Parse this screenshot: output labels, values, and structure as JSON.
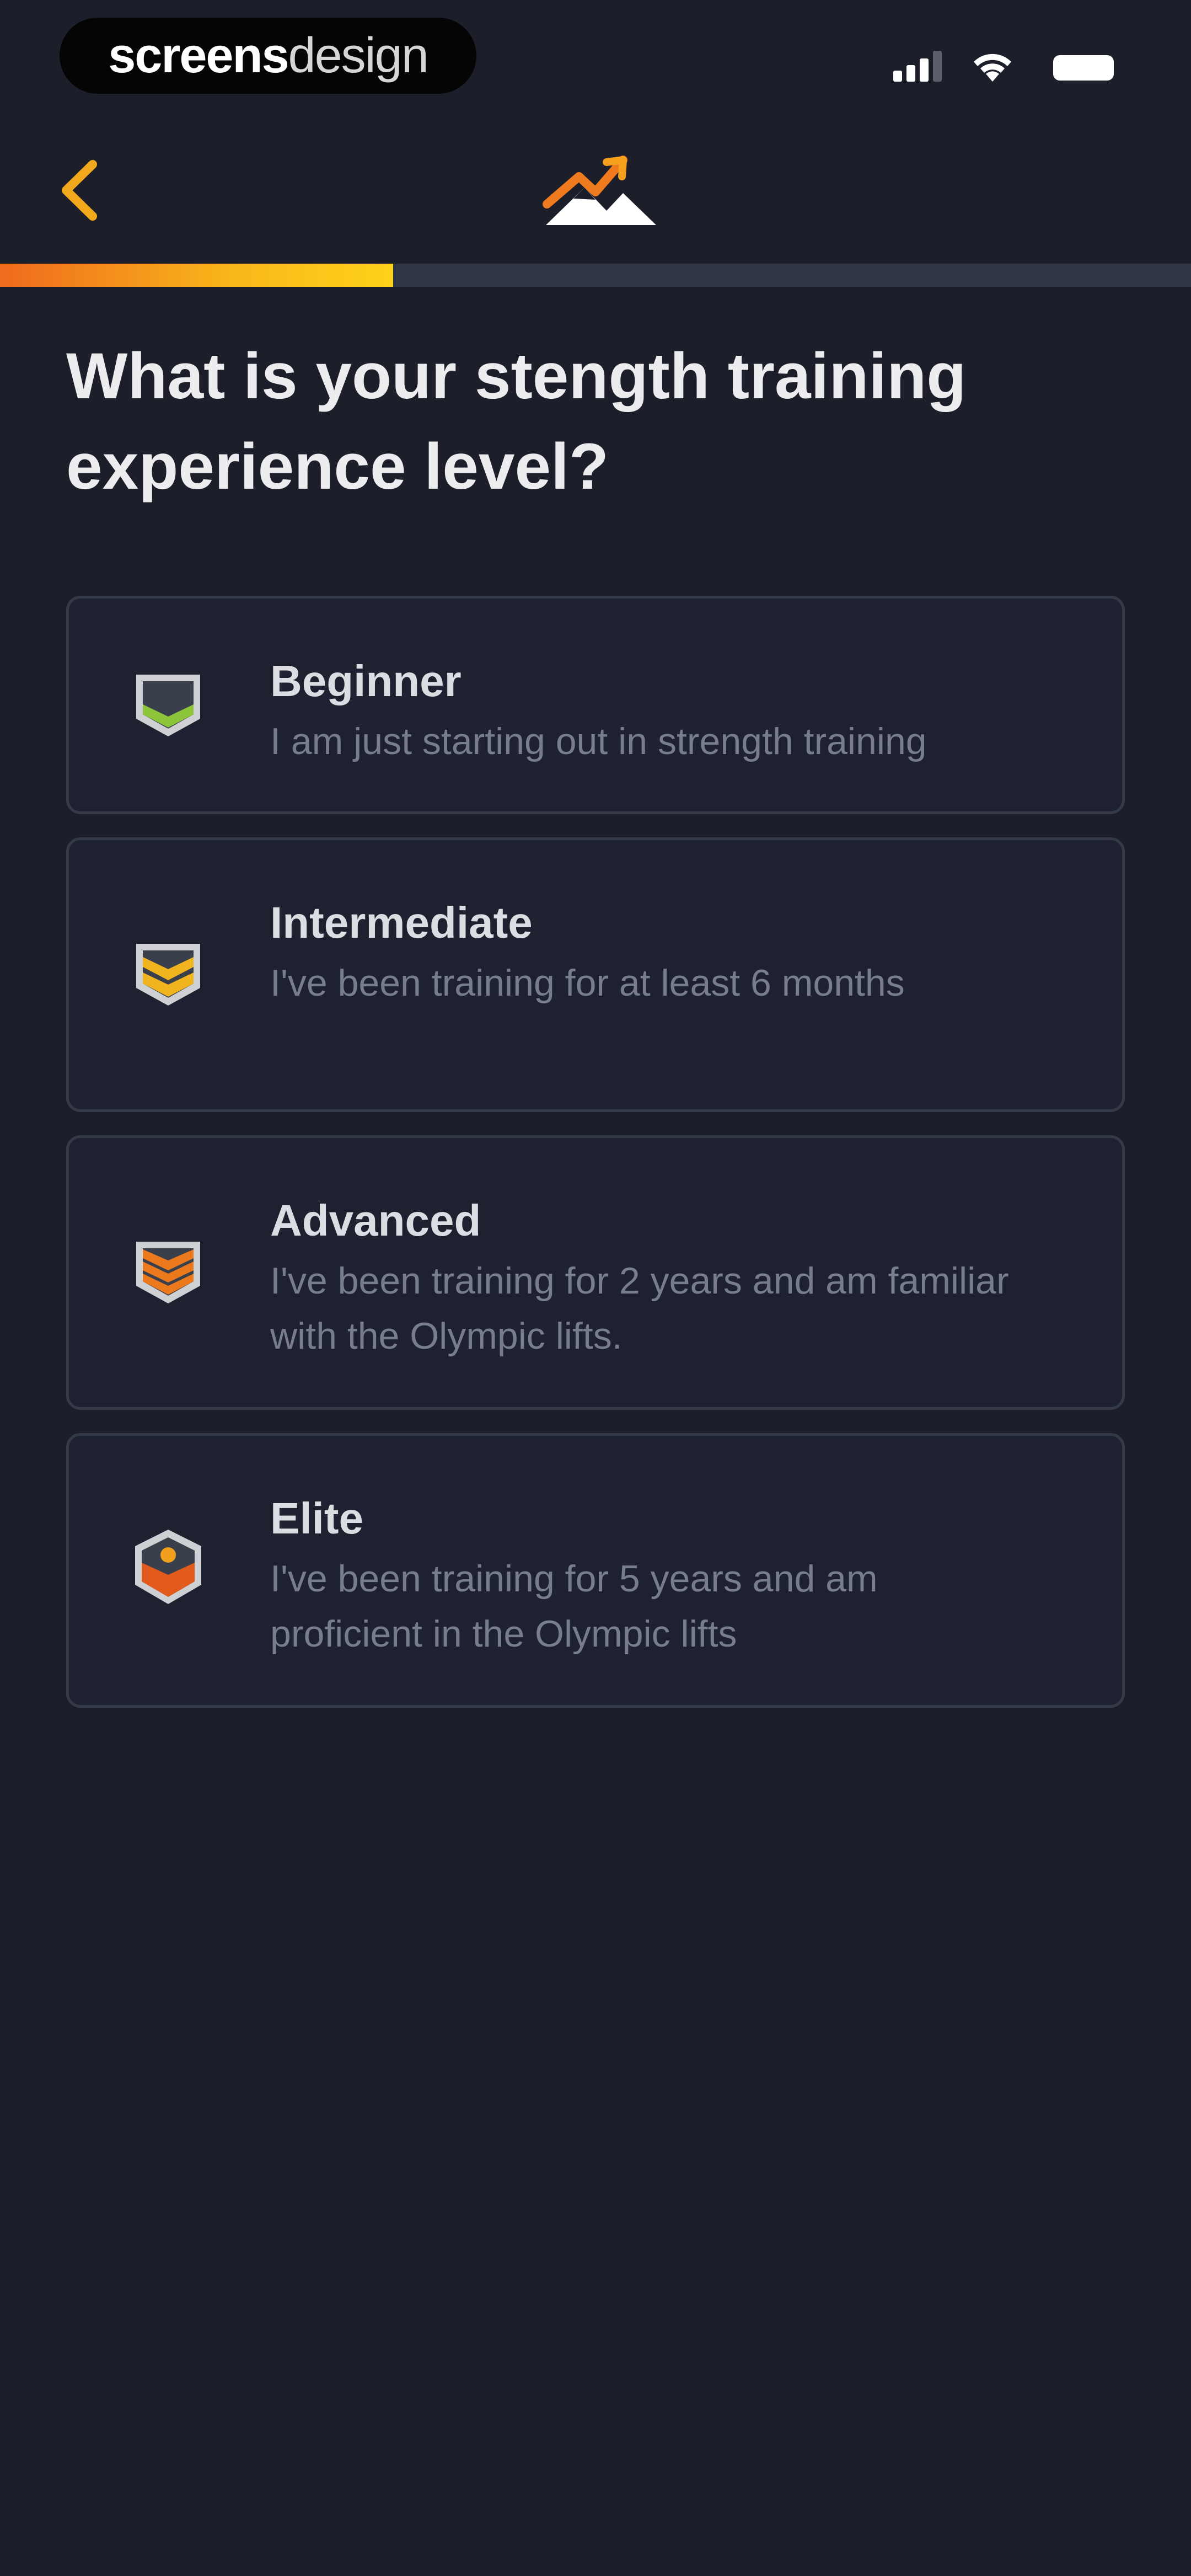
{
  "status_bar": {
    "watermark_bold": "screens",
    "watermark_light": "design"
  },
  "nav": {
    "back_icon": "chevron-left-icon",
    "logo_icon": "mountain-logo-icon"
  },
  "progress": {
    "value": 0.33,
    "colors": [
      "#f06a1e",
      "#ffd21a"
    ]
  },
  "title": "What is your stength training experience level?",
  "options": [
    {
      "title": "Beginner",
      "description": "I am just starting out in strength training",
      "icon": "beginner-chevron-badge-icon",
      "color": "#8cc43a"
    },
    {
      "title": "Intermediate",
      "description": "I've been training for at least 6 months",
      "icon": "intermediate-chevron-badge-icon",
      "color": "#f0b41e"
    },
    {
      "title": "Advanced",
      "description": "I've been training for 2 years and am familiar with the Olympic lifts.",
      "icon": "advanced-chevron-badge-icon",
      "color": "#ec7a1c"
    },
    {
      "title": "Elite",
      "description": "I've been training for 5 years and am proficient in the Olympic lifts",
      "icon": "elite-star-badge-icon",
      "color": "#e25a1c"
    }
  ]
}
